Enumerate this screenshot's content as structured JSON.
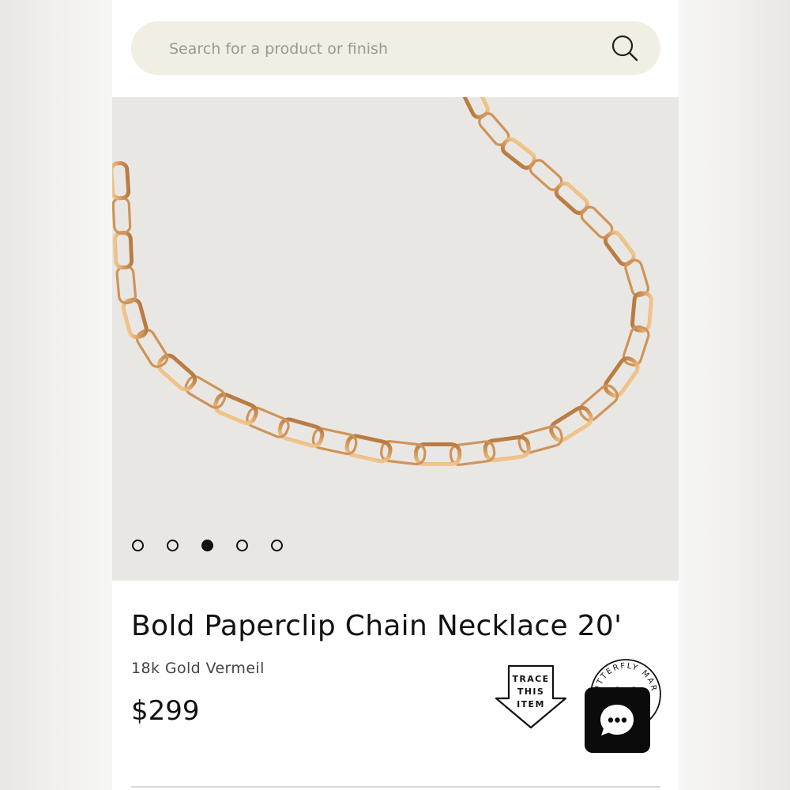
{
  "search": {
    "placeholder": "Search for a product or finish",
    "icon": "search-icon"
  },
  "gallery": {
    "image_alt": "Bold Paperclip Chain Necklace in gold",
    "slide_count": 5,
    "active_slide": 3
  },
  "product": {
    "title": "Bold Paperclip Chain Necklace 20'",
    "finish": "18k Gold Vermeil",
    "price": "$299"
  },
  "badges": {
    "trace": [
      "TRACE",
      "THIS",
      "ITEM"
    ],
    "mark_text": "BUTTERFLY MARK"
  },
  "chat": {
    "icon": "chat-bubble-icon"
  },
  "colors": {
    "search_bg": "#f1efe3",
    "hero_bg": "#e9e7e3",
    "chain_gold": "#d9a165",
    "text": "#111111"
  }
}
